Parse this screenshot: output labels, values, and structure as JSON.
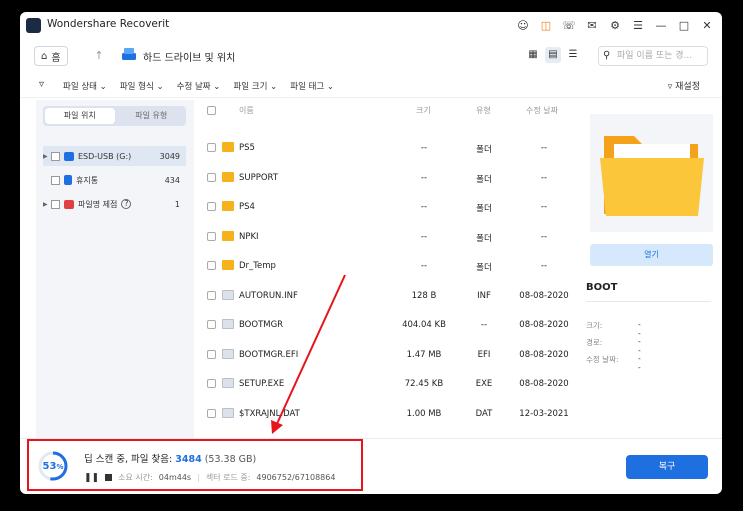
{
  "window": {
    "title": "Wondershare Recoverit"
  },
  "nav": {
    "home_label": "홈",
    "breadcrumb": "하드 드라이브 및 위치",
    "search_placeholder": "파일 이름 또는 경..."
  },
  "filters": {
    "items": [
      "파일 상태",
      "파일 형식",
      "수정 날짜",
      "파일 크기",
      "파일 태그"
    ],
    "reset_label": "재설정"
  },
  "sidebar": {
    "tab_location": "파일 위치",
    "tab_type": "파일 유형",
    "items": [
      {
        "label": "ESD-USB (G:)",
        "count": "3049"
      },
      {
        "label": "휴지통",
        "count": "434"
      },
      {
        "label": "파일명 제점",
        "count": "1"
      }
    ]
  },
  "filelist": {
    "headers": {
      "name": "이름",
      "size": "크기",
      "type": "유형",
      "date": "수정 날짜"
    },
    "rows": [
      {
        "name": "PS5",
        "size": "--",
        "type": "폴더",
        "date": "--",
        "kind": "folder"
      },
      {
        "name": "SUPPORT",
        "size": "--",
        "type": "폴더",
        "date": "--",
        "kind": "folder"
      },
      {
        "name": "PS4",
        "size": "--",
        "type": "폴더",
        "date": "--",
        "kind": "folder"
      },
      {
        "name": "NPKI",
        "size": "--",
        "type": "폴더",
        "date": "--",
        "kind": "folder"
      },
      {
        "name": "Dr_Temp",
        "size": "--",
        "type": "폴더",
        "date": "--",
        "kind": "folder"
      },
      {
        "name": "AUTORUN.INF",
        "size": "128 B",
        "type": "INF",
        "date": "08-08-2020",
        "kind": "file"
      },
      {
        "name": "BOOTMGR",
        "size": "404.04 KB",
        "type": "--",
        "date": "08-08-2020",
        "kind": "file"
      },
      {
        "name": "BOOTMGR.EFI",
        "size": "1.47 MB",
        "type": "EFI",
        "date": "08-08-2020",
        "kind": "file"
      },
      {
        "name": "SETUP.EXE",
        "size": "72.45 KB",
        "type": "EXE",
        "date": "08-08-2020",
        "kind": "file"
      },
      {
        "name": "$TXRAJNL.DAT",
        "size": "1.00 MB",
        "type": "DAT",
        "date": "12-03-2021",
        "kind": "file"
      }
    ]
  },
  "preview": {
    "open_label": "열기",
    "name": "BOOT",
    "meta": [
      {
        "label": "크기:",
        "value": "--"
      },
      {
        "label": "경로:",
        "value": "--"
      },
      {
        "label": "수정 날짜:",
        "value": "--"
      }
    ]
  },
  "status": {
    "progress_percent": 53,
    "pct_number": "53",
    "pct_unit": "%",
    "scan_prefix": "딥 스캔 중, 파일 찾음: ",
    "found_count": "3484",
    "found_size": " (53.38 GB)",
    "elapsed_label": "소요 시간:",
    "elapsed_value": "04m44s",
    "sector_label": "섹터 로드 중:",
    "sector_value": "4906752/67108864",
    "recover_label": "복구"
  },
  "colors": {
    "accent": "#1e6fe0",
    "folder": "#f6b21a",
    "highlight": "#e8141b"
  }
}
